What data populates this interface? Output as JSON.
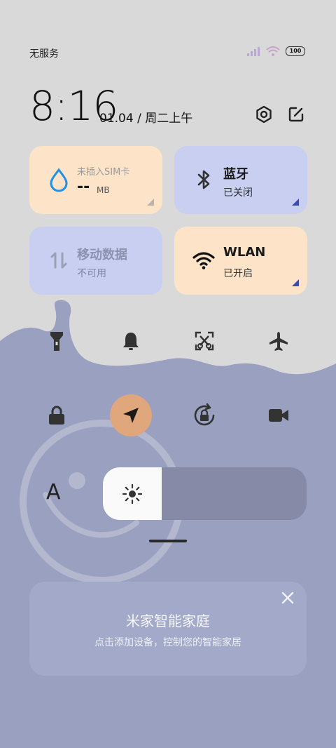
{
  "status_bar": {
    "carrier": "无服务",
    "battery": "100"
  },
  "header": {
    "time": "8:16",
    "date": "01.04 / 周二上午"
  },
  "tiles": {
    "data_usage": {
      "title": "--",
      "unit": "MB",
      "subtitle": "未插入SIM卡"
    },
    "bluetooth": {
      "title": "蓝牙",
      "subtitle": "已关闭"
    },
    "mobile_data": {
      "title": "移动数据",
      "subtitle": "不可用"
    },
    "wlan": {
      "title": "WLAN",
      "subtitle": "已开启"
    }
  },
  "icons": {
    "row1": [
      "flashlight-icon",
      "bell-icon",
      "screenshot-icon",
      "airplane-icon"
    ],
    "row2": [
      "lock-icon",
      "location-icon",
      "rotation-lock-icon",
      "video-icon"
    ],
    "settings": "gear-icon",
    "edit": "edit-icon"
  },
  "brightness": {
    "auto_label": "A",
    "level_percent": 29
  },
  "mijia_card": {
    "title": "米家智能家庭",
    "subtitle": "点击添加设备，控制您的智能家居"
  },
  "colors": {
    "orange_tile": "#fde4c9",
    "blue_tile": "#c9cff0",
    "wave": "#9aa0bf",
    "location_active": "#e0a67c"
  }
}
